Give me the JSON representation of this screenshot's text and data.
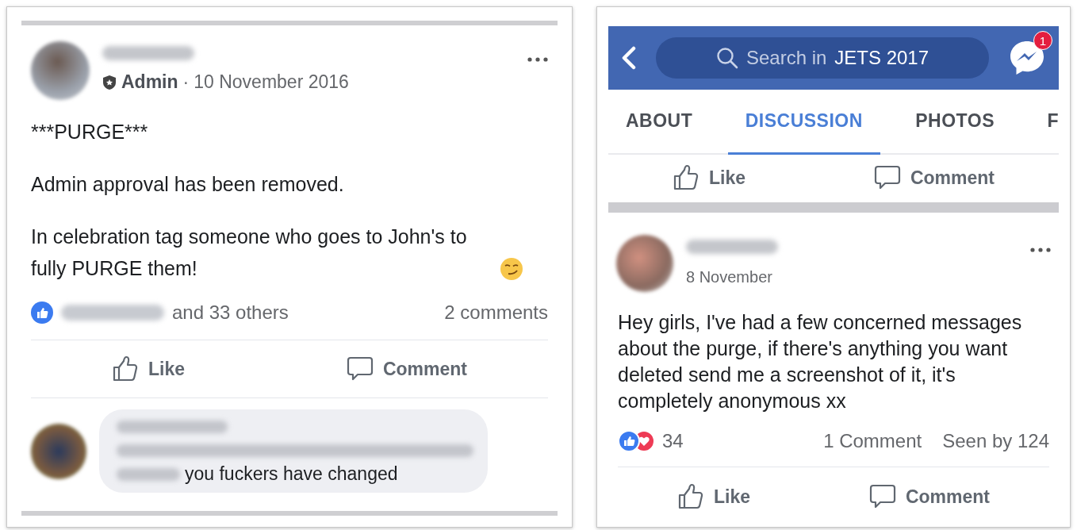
{
  "left_panel": {
    "post": {
      "role": "Admin",
      "separator": "·",
      "date": "10 November 2016",
      "paragraphs": [
        "***PURGE***",
        "Admin approval has been removed.",
        "In celebration tag someone who goes to John's to fully PURGE them!"
      ],
      "reactions_text": "and 33 others",
      "comments_count": "2 comments",
      "actions": [
        {
          "kind": "like",
          "label": "Like"
        },
        {
          "kind": "comment",
          "label": "Comment"
        }
      ],
      "comment": {
        "text": "you fuckers have changed"
      }
    }
  },
  "right_panel": {
    "header": {
      "search_prefix": "Search in",
      "search_group": "JETS 2017",
      "messenger_badge": "1"
    },
    "tabs": [
      {
        "label": "ABOUT",
        "selected": false
      },
      {
        "label": "DISCUSSION",
        "selected": true
      },
      {
        "label": "PHOTOS",
        "selected": false
      },
      {
        "label": "F",
        "selected": false
      }
    ],
    "previous_post_actions": [
      {
        "kind": "like",
        "label": "Like"
      },
      {
        "kind": "comment",
        "label": "Comment"
      }
    ],
    "post": {
      "date": "8 November",
      "text": "Hey girls, I've had a few concerned messages about the purge, if there's anything you want deleted send me a screenshot of it, it's completely anonymous xx",
      "reaction_count": "34",
      "comments_count": "1 Comment",
      "seen_by": "Seen by 124",
      "actions": [
        {
          "kind": "like",
          "label": "Like"
        },
        {
          "kind": "comment",
          "label": "Comment"
        }
      ]
    }
  }
}
